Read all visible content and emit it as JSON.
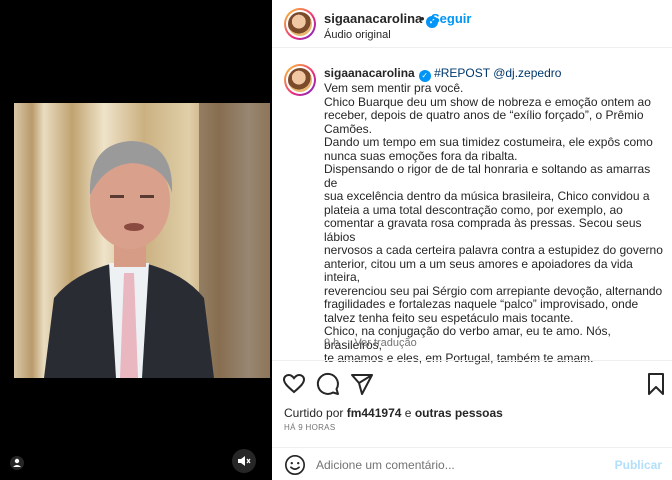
{
  "header": {
    "username": "sigaanacarolina",
    "separator": "•",
    "follow_label": "Seguir",
    "audio": "Áudio original"
  },
  "caption": {
    "username": "sigaanacarolina",
    "repost_tag": "#REPOST @dj.zepedro",
    "lines": [
      "Vem sem mentir pra você.",
      "Chico Buarque deu um show de nobreza e emoção ontem ao",
      "receber, depois de quatro anos de “exílio forçado”, o Prêmio",
      "Camões.",
      "Dando um tempo em sua timidez costumeira, ele expôs como",
      "nunca suas emoções fora da ribalta.",
      "Dispensando o rigor de de tal honraria e soltando as amarras de",
      "sua excelência dentro da música brasileira, Chico convidou a",
      "plateia a uma total descontração como, por exemplo, ao",
      "comentar a gravata rosa comprada às pressas. Secou seus lábios",
      "nervosos a cada certeira palavra contra a estupidez do governo",
      "anterior, citou um a um seus amores e apoiadores da vida inteira,",
      "reverenciou seu pai Sérgio com arrepiante devoção, alternando",
      "fragilidades e fortalezas naquele “palco” improvisado, onde",
      "talvez tenha feito seu espetáculo mais tocante.",
      "Chico, na conjugação do verbo amar, eu te amo. Nós, brasileiros,",
      "te amamos e eles, em Portugal, também te amam."
    ],
    "age": "9 h",
    "translate_label": "Ver tradução"
  },
  "likes": {
    "prefix": "Curtido por",
    "user": "fm441974",
    "middle": "e",
    "others": "outras pessoas"
  },
  "timestamp": "HÁ 9 HORAS",
  "comment": {
    "placeholder": "Adicione um comentário...",
    "publish_label": "Publicar"
  },
  "icons": {
    "like": "heart-icon",
    "comment": "comment-icon",
    "share": "send-icon",
    "save": "bookmark-icon",
    "emoji": "emoji-icon",
    "mute": "speaker-muted-icon",
    "tagged": "user-tag-icon",
    "verified": "verified-badge-icon"
  },
  "colors": {
    "link_blue": "#0095f6",
    "publish_disabled": "#b2dffc",
    "tag_blue": "#00376b",
    "secondary_text": "#737373"
  }
}
